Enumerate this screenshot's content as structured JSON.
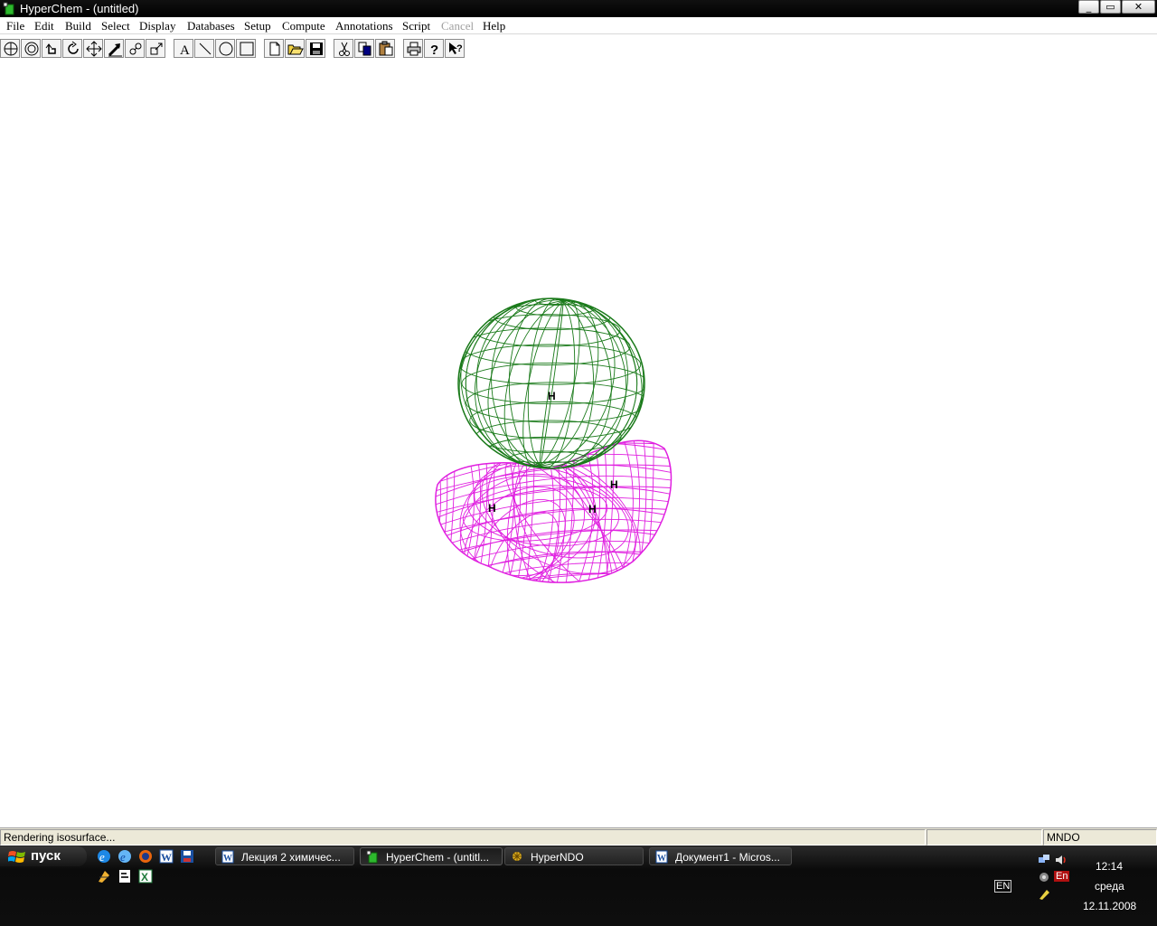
{
  "window": {
    "title": "HyperChem - (untitled)",
    "controls": {
      "minimize": "_",
      "maximize": "▭",
      "close": "✕"
    }
  },
  "menubar": {
    "items": [
      "File",
      "Edit",
      "Build",
      "Select",
      "Display",
      "Databases",
      "Setup",
      "Compute",
      "Annotations",
      "Script",
      "Cancel",
      "Help"
    ],
    "disabled": [
      "Cancel"
    ]
  },
  "toolbar": {
    "tools": [
      "draw-tool-icon",
      "select-tool-icon",
      "rotate-xy-tool-icon",
      "rotate-z-tool-icon",
      "translate-tool-icon",
      "translate-z-tool-icon",
      "zoom-tool-icon",
      "clip-tool-icon"
    ],
    "annotation_tools": [
      "text-annotation-icon",
      "line-annotation-icon",
      "ellipse-annotation-icon",
      "rectangle-annotation-icon"
    ],
    "file_tools": [
      "new-file-icon",
      "open-file-icon",
      "save-file-icon"
    ],
    "edit_tools": [
      "cut-icon",
      "copy-icon",
      "paste-icon"
    ],
    "misc_tools": [
      "print-icon",
      "help-icon",
      "context-help-icon"
    ],
    "text_tool_label": "A"
  },
  "molecule": {
    "atoms": [
      {
        "label": "H"
      },
      {
        "label": "H"
      },
      {
        "label": "H"
      },
      {
        "label": "H"
      }
    ],
    "isosurface_colors": {
      "positive_lobe": "#1a7a1a",
      "negative_lobe": "#e020e0"
    }
  },
  "statusbar": {
    "message": "Rendering isosurface...",
    "middle": "",
    "method": "MNDO"
  },
  "taskbar": {
    "start_label": "пуск",
    "quick_launch": [
      "ie-icon",
      "ie-alt-icon",
      "firefox-icon",
      "word-icon",
      "save-disk-icon",
      "shortcut-icon",
      "document-icon",
      "excel-icon"
    ],
    "tasks": [
      {
        "label": "Лекция 2 химичес...",
        "icon": "word-doc-icon",
        "active": false
      },
      {
        "label": "HyperChem - (untitl...",
        "icon": "hyperchem-icon",
        "active": true
      },
      {
        "label": "HyperNDO",
        "icon": "hyperndo-icon",
        "active": false
      },
      {
        "label": "Документ1 - Micros...",
        "icon": "word-doc-icon",
        "active": false
      }
    ],
    "tray": {
      "language": "EN",
      "lang_badge": "En",
      "time": "12:14",
      "day": "среда",
      "date": "12.11.2008"
    }
  },
  "colors": {
    "accent": "#000000",
    "workspace": "#ffffff",
    "green_mesh": "#1a7a1a",
    "magenta_mesh": "#e020e0"
  }
}
